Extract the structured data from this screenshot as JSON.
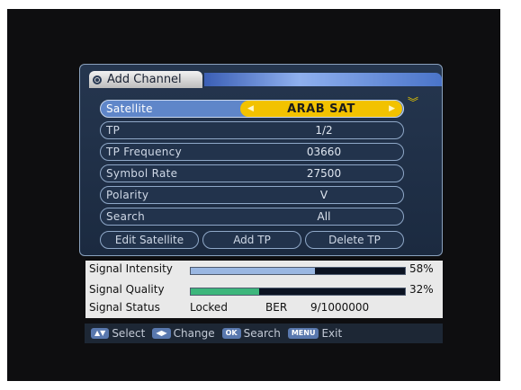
{
  "dialog": {
    "title": "Add Channel"
  },
  "rows": [
    {
      "label": "Satellite",
      "value": "ARAB SAT"
    },
    {
      "label": "TP",
      "value": "1/2"
    },
    {
      "label": "TP Frequency",
      "value": "03660"
    },
    {
      "label": "Symbol Rate",
      "value": "27500"
    },
    {
      "label": "Polarity",
      "value": "V"
    },
    {
      "label": "Search",
      "value": "All"
    }
  ],
  "buttons": {
    "edit_satellite": "Edit Satellite",
    "add_tp": "Add TP",
    "delete_tp": "Delete TP"
  },
  "signal": {
    "intensity_label": "Signal Intensity",
    "intensity_value": "58%",
    "intensity_level": 0.58,
    "quality_label": "Signal Quality",
    "quality_value": "32%",
    "quality_level": 0.32,
    "status_label": "Signal Status",
    "status_value": "Locked",
    "ber_label": "BER",
    "ber_value": "9/1000000"
  },
  "help": {
    "select_key": "▲▼",
    "select": "Select",
    "change_key": "◀▶",
    "change": "Change",
    "ok_key": "OK",
    "search": "Search",
    "menu_key": "MENU",
    "exit": "Exit"
  },
  "colors": {
    "selected_row": "#5f86c9",
    "selected_value": "#f2c200",
    "intensity_bar": "#9ab7e2",
    "quality_bar": "#3db67c"
  }
}
